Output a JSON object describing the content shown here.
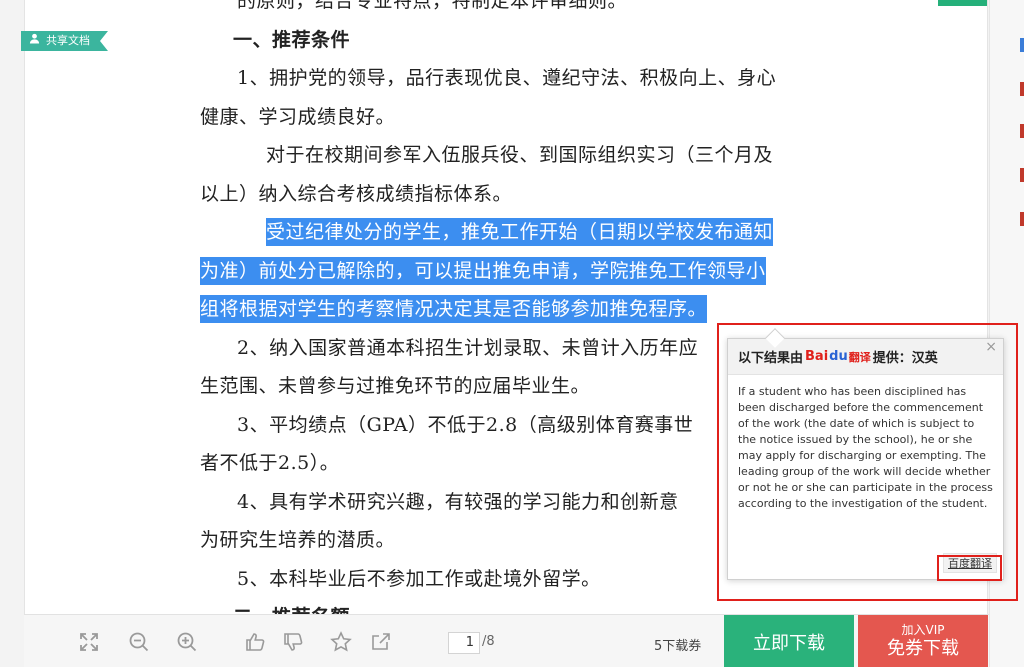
{
  "share_badge": "共享文档",
  "doc": {
    "top_fragment": "的原则，结合专业特点，特制定本评审细则。",
    "heading1": "一、推荐条件",
    "p1_a": "1、拥护党的领导，品行表现优良、遵纪守法、积极向上、身心",
    "p1_b": "健康、学习成绩良好。",
    "p2_a": "对于在校期间参军入伍服兵役、到国际组织实习（三个月及",
    "p2_b": "以上）纳入综合考核成绩指标体系。",
    "hl_1": "受过纪律处分的学生，推免工作开始（日期以学校发布通知",
    "hl_2": "为准）前处分已解除的，可以提出推免申请，学院推免工作领导小",
    "hl_3": "组将根据对学生的考察情况决定其是否能够参加推免程序。",
    "p3_a": "2、纳入国家普通本科招生计划录取、未曾计入历年应",
    "p3_b": "生范围、未曾参与过推免环节的应届毕业生。",
    "p4_a": "3、平均绩点（GPA）不低于2.8（高级别体育赛事世",
    "p4_b": "者不低于2.5）。",
    "p5_a": "4、具有学术研究兴趣，有较强的学习能力和创新意",
    "p5_b": "为研究生培养的潜质。",
    "p6": "5、本科毕业后不参加工作或赴境外留学。",
    "heading2": "二、推荐名额"
  },
  "translation": {
    "head_prefix": "以下结果由",
    "logo_bai": "Bai",
    "logo_paw": "du",
    "logo_fanyi": "翻译",
    "head_suffix": "提供：汉英",
    "close": "×",
    "text": "If a student who has been disciplined has been discharged before the commencement of the work (the date of which is subject to the notice issued by the school), he or she may apply for discharging or exempting. The leading group of the work will decide whether or not he or she can participate in the process according to the investigation of the student.",
    "source_link": "百度翻译"
  },
  "toolbar": {
    "icons": [
      "fullscreen-icon",
      "zoom-out-icon",
      "zoom-in-icon",
      "thumbs-up-icon",
      "thumbs-down-icon",
      "star-icon",
      "share-icon"
    ],
    "current_page": "1",
    "total_pages": "/8",
    "coupon": "5下载券",
    "download_button": "立即下载",
    "vip_small": "加入VIP",
    "vip_big": "免券下载"
  },
  "colors": {
    "green": "#2ab27b",
    "red": "#e4574f",
    "highlight": "#3c8ef0",
    "outline": "#e0201b"
  }
}
